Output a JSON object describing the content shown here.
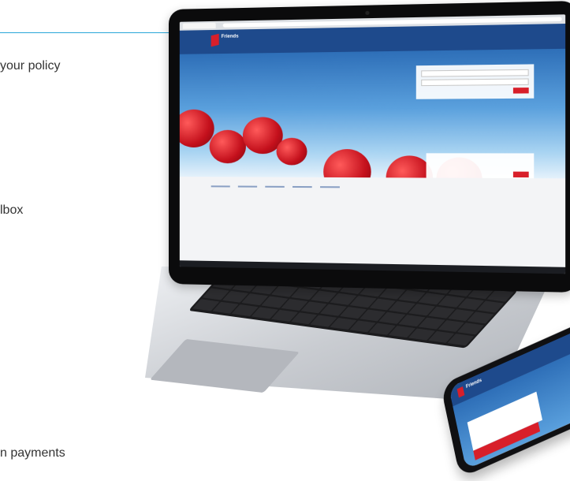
{
  "side_text": {
    "line1": "your policy",
    "line2": "lbox",
    "line3": "n payments"
  },
  "laptop": {
    "brand": "Friends",
    "colors": {
      "header": "#1e4a8c",
      "accent": "#d81f2a",
      "sky": "#5aa0dd"
    }
  },
  "phone": {
    "brand": "Friends"
  }
}
